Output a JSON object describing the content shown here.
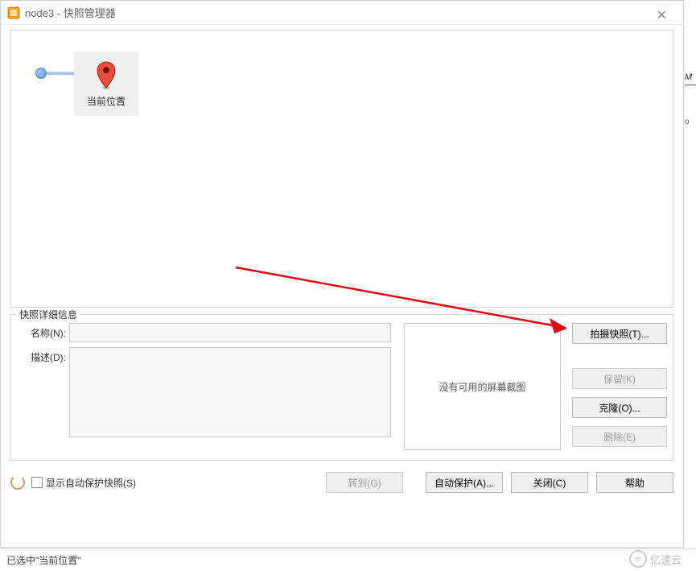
{
  "window": {
    "title": "node3 - 快照管理器"
  },
  "tree": {
    "current_node_label": "当前位置"
  },
  "details": {
    "legend": "快照详细信息",
    "name_label": "名称(N):",
    "name_value": "",
    "desc_label": "描述(D):",
    "desc_value": "",
    "thumbnail_placeholder": "没有可用的屏幕截图",
    "buttons": {
      "take": "拍摄快照(T)...",
      "keep": "保留(K)",
      "clone": "克隆(O)...",
      "delete": "删除(E)"
    }
  },
  "bottom": {
    "checkbox_label": "显示自动保护快照(S)",
    "goto": "转到(G)",
    "autoprotect": "自动保护(A)...",
    "close": "关闭(C)",
    "help": "帮助"
  },
  "status": {
    "text": "已选中\"当前位置\""
  },
  "watermark": "亿速云"
}
